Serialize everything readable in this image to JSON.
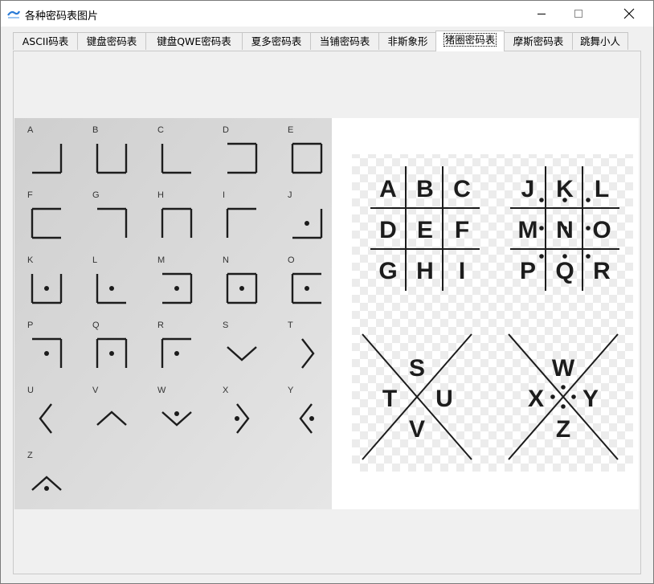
{
  "window": {
    "title": "各种密码表图片"
  },
  "tabs": [
    {
      "label": "ASCII码表",
      "active": false
    },
    {
      "label": "键盘密码表",
      "active": false
    },
    {
      "label": "键盘QWE密码表",
      "active": false
    },
    {
      "label": "夏多密码表",
      "active": false
    },
    {
      "label": "当铺密码表",
      "active": false
    },
    {
      "label": "非斯象形",
      "active": false
    },
    {
      "label": "猪圈密码表",
      "active": true
    },
    {
      "label": "摩斯密码表",
      "active": false
    },
    {
      "label": "跳舞小人",
      "active": false
    }
  ],
  "left_chart": {
    "letters": [
      "A",
      "B",
      "C",
      "D",
      "E",
      "F",
      "G",
      "H",
      "I",
      "J",
      "K",
      "L",
      "M",
      "N",
      "O",
      "P",
      "Q",
      "R",
      "S",
      "T",
      "U",
      "V",
      "W",
      "X",
      "Y",
      "Z"
    ]
  },
  "right_chart": {
    "grid1": [
      "A",
      "B",
      "C",
      "D",
      "E",
      "F",
      "G",
      "H",
      "I"
    ],
    "grid2": [
      "J",
      "K",
      "L",
      "M",
      "N",
      "O",
      "P",
      "Q",
      "R"
    ],
    "x1": [
      "S",
      "T",
      "U",
      "V"
    ],
    "x2": [
      "W",
      "X",
      "Y",
      "Z"
    ]
  },
  "colors": {
    "accent": "#1e6fd1",
    "ink": "#1c1c1c",
    "photo_bg": "#d9d9d9"
  }
}
